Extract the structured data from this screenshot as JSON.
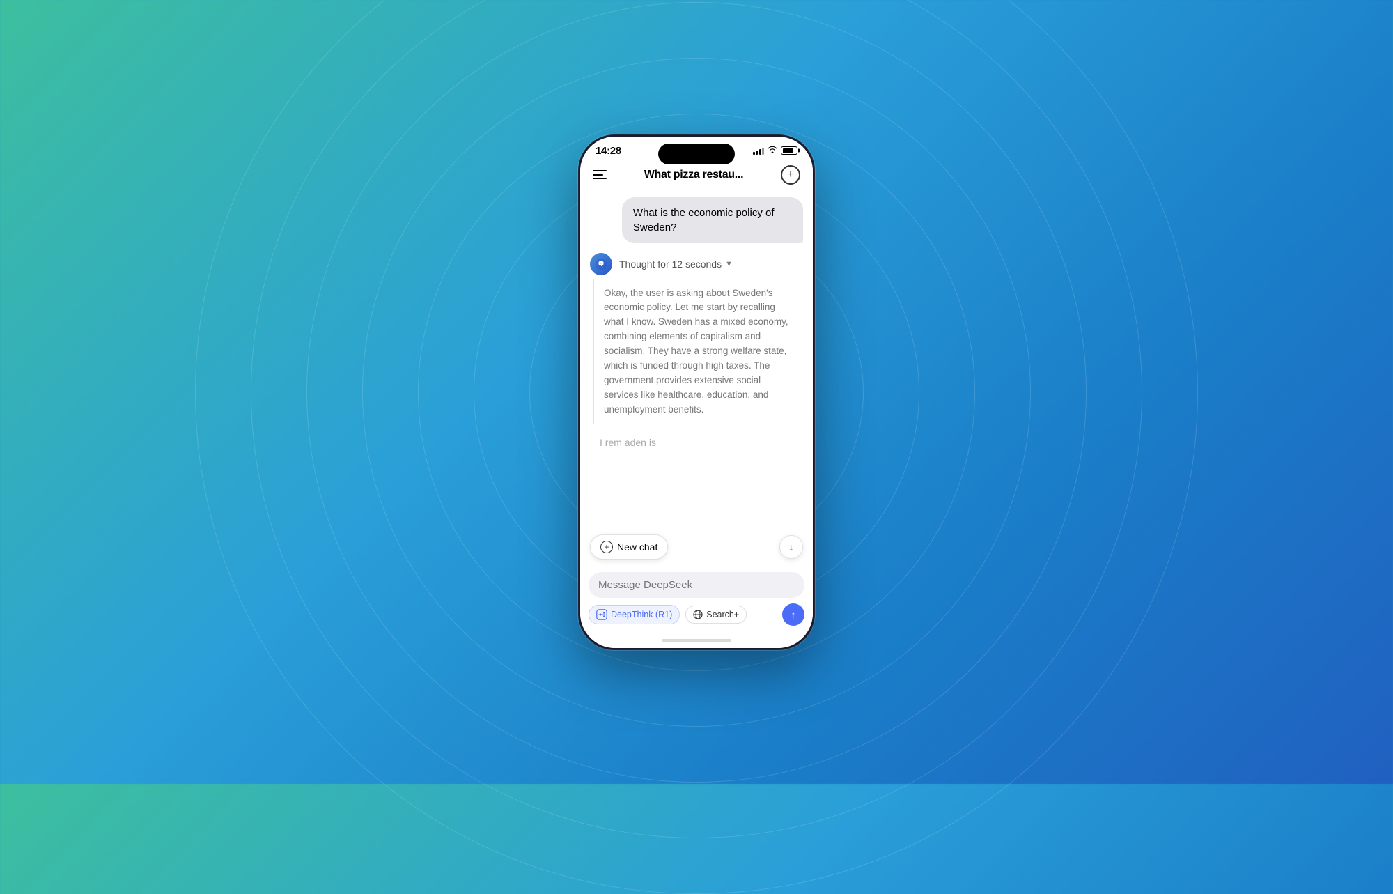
{
  "background": {
    "gradient_start": "#3dbf9e",
    "gradient_end": "#2060c0"
  },
  "status_bar": {
    "time": "14:28",
    "signal_strength": 3,
    "battery_percent": 80
  },
  "nav": {
    "title": "What pizza restau...",
    "add_label": "+"
  },
  "chat": {
    "user_message": "What is the economic policy of Sweden?",
    "thought_label": "Thought for 12 seconds",
    "thought_chevron": "▼",
    "thought_content": "Okay, the user is asking about Sweden's economic policy. Let me start by recalling what I know. Sweden has a mixed economy, combining elements of capitalism and socialism. They have a strong welfare state, which is funded through high taxes. The government provides extensive social services like healthcare, education, and unemployment benefits.",
    "partial_text": "I rem                aden is",
    "new_chat_label": "New chat",
    "scroll_down_label": "↓"
  },
  "input": {
    "placeholder": "Message DeepSeek",
    "deepthink_label": "DeepThink (R1)",
    "search_label": "Search+",
    "send_icon": "↑"
  },
  "ripples": [
    80,
    160,
    240,
    320,
    400,
    480,
    560,
    640,
    720
  ]
}
